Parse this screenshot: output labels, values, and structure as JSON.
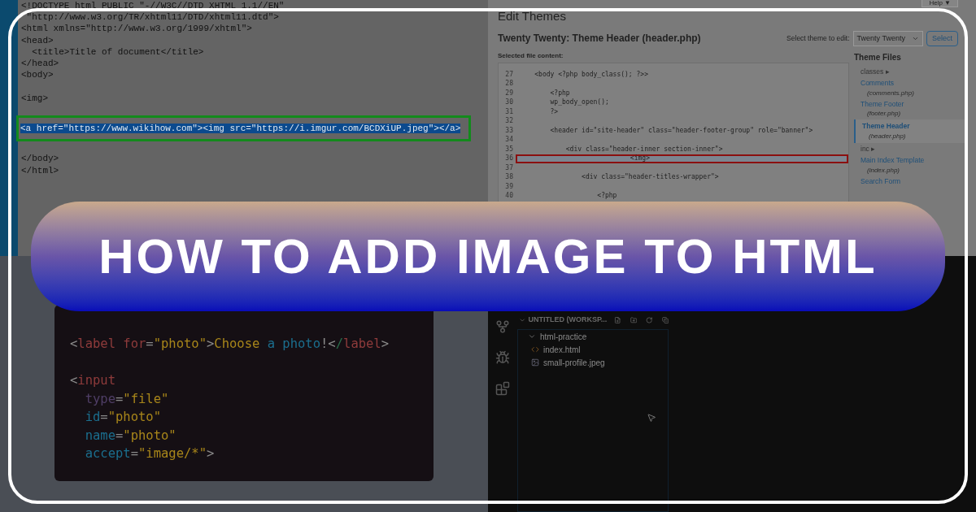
{
  "title": "HOW TO ADD IMAGE TO HTML",
  "xhtml_editor": {
    "lines": [
      {
        "kind": "code",
        "text": "<!DOCTYPE html PUBLIC \"-//W3C//DTD XHTML 1.1//EN\""
      },
      {
        "kind": "code",
        "text": " \"http://www.w3.org/TR/xhtml11/DTD/xhtml11.dtd\">"
      },
      {
        "kind": "code",
        "text": "<html xmlns=\"http://www.w3.org/1999/xhtml\">"
      },
      {
        "kind": "code",
        "text": "<head>"
      },
      {
        "kind": "code",
        "text": "  <title>Title of document</title>"
      },
      {
        "kind": "code",
        "text": "</head>"
      },
      {
        "kind": "code",
        "text": "<body>"
      },
      {
        "kind": "blank"
      },
      {
        "kind": "code",
        "text": "<img>"
      },
      {
        "kind": "blank"
      },
      {
        "kind": "highlighted",
        "text": "<a href=\"https://www.wikihow.com\"><img src=\"https://i.imgur.com/BCDXiUP.jpeg\"></a>"
      },
      {
        "kind": "blank"
      },
      {
        "kind": "code",
        "text": "</body>"
      },
      {
        "kind": "code",
        "text": "</html>"
      }
    ]
  },
  "theme_editor": {
    "help": "Help ▼",
    "heading": "Edit Themes",
    "file_title": "Twenty Twenty: Theme Header (header.php)",
    "select_label": "Select theme to edit:",
    "select_value": "Twenty Twenty",
    "select_button": "Select",
    "content_label": "Selected file content:",
    "code_lines": [
      {
        "number": "27",
        "text": "    <body <?php body_class(); ?>>",
        "selected": false
      },
      {
        "number": "28",
        "selected": false
      },
      {
        "number": "29",
        "text": "        <?php",
        "selected": false
      },
      {
        "number": "30",
        "text": "        wp_body_open();",
        "selected": false
      },
      {
        "number": "31",
        "text": "        ?>",
        "selected": false
      },
      {
        "number": "32",
        "selected": false
      },
      {
        "number": "33",
        "text": "        <header id=\"site-header\" class=\"header-footer-group\" role=\"banner\">",
        "selected": false
      },
      {
        "number": "34",
        "selected": false
      },
      {
        "number": "35",
        "text": "            <div class=\"header-inner section-inner\">",
        "selected": false
      },
      {
        "number": "36",
        "text": "                            <img>",
        "selected": true
      },
      {
        "number": "37",
        "selected": false
      },
      {
        "number": "38",
        "text": "                <div class=\"header-titles-wrapper\">",
        "selected": false
      },
      {
        "number": "39",
        "selected": false
      },
      {
        "number": "40",
        "text": "                    <?php",
        "selected": false
      }
    ],
    "files_heading": "Theme Files",
    "files": [
      {
        "kind": "folder",
        "name": "classes ▸"
      },
      {
        "kind": "file",
        "name": "Comments",
        "file": "(comments.php)",
        "selected": false
      },
      {
        "kind": "file",
        "name": "Theme Footer",
        "file": "(footer.php)",
        "selected": false
      },
      {
        "kind": "file",
        "name": "Theme Header",
        "file": "(header.php)",
        "selected": true
      },
      {
        "kind": "folder",
        "name": "inc ▸"
      },
      {
        "kind": "file",
        "name": "Main Index Template",
        "file": "(index.php)",
        "selected": false
      },
      {
        "kind": "file",
        "name": "Search Form",
        "selected": false
      }
    ]
  },
  "code_card": {
    "lines": [
      {
        "kind": "code",
        "tokens": [
          {
            "text": "<",
            "color": "#8a8a8a"
          },
          {
            "text": "label ",
            "color": "#8e3b3b"
          },
          {
            "text": "for",
            "color": "#8e3b3b"
          },
          {
            "text": "=",
            "color": "#8a8a8a"
          },
          {
            "text": "\"photo\"",
            "color": "#a8861a"
          },
          {
            "text": ">",
            "color": "#8a8a8a"
          },
          {
            "text": "Choose ",
            "color": "#a8861a"
          },
          {
            "text": "a photo",
            "color": "#1b6e8e"
          },
          {
            "text": "!",
            "color": "#8a8a8a"
          },
          {
            "text": "<",
            "color": "#8a8a8a"
          },
          {
            "text": "/",
            "color": "#2a6e4a"
          },
          {
            "text": "label",
            "color": "#8e3b3b"
          },
          {
            "text": ">",
            "color": "#8a8a8a"
          }
        ]
      },
      {
        "kind": "blank"
      },
      {
        "kind": "code",
        "tokens": [
          {
            "text": "<",
            "color": "#8a8a8a"
          },
          {
            "text": "input",
            "color": "#8e3b3b"
          }
        ]
      },
      {
        "kind": "code",
        "tokens": [
          {
            "text": "  type",
            "color": "#4f3e66"
          },
          {
            "text": "=",
            "color": "#8a8a8a"
          },
          {
            "text": "\"file\"",
            "color": "#a8861a"
          }
        ]
      },
      {
        "kind": "code",
        "tokens": [
          {
            "text": "  id",
            "color": "#1b6e8e"
          },
          {
            "text": "=",
            "color": "#8a8a8a"
          },
          {
            "text": "\"photo\"",
            "color": "#a8861a"
          }
        ]
      },
      {
        "kind": "code",
        "tokens": [
          {
            "text": "  name",
            "color": "#1b6e8e"
          },
          {
            "text": "=",
            "color": "#8a8a8a"
          },
          {
            "text": "\"photo\"",
            "color": "#a8861a"
          }
        ]
      },
      {
        "kind": "code",
        "tokens": [
          {
            "text": "  accept",
            "color": "#1b6e8e"
          },
          {
            "text": "=",
            "color": "#8a8a8a"
          },
          {
            "text": "\"image/*\"",
            "color": "#a8861a"
          },
          {
            "text": ">",
            "color": "#8a8a8a"
          }
        ]
      }
    ]
  },
  "explorer": {
    "header": "UNTITLED (WORKSP...",
    "items": [
      {
        "kind": "folder",
        "name": "html-practice",
        "expanded": true,
        "children": [
          {
            "kind": "html",
            "name": "index.html"
          },
          {
            "kind": "image",
            "name": "small-profile.jpeg"
          }
        ]
      }
    ]
  }
}
